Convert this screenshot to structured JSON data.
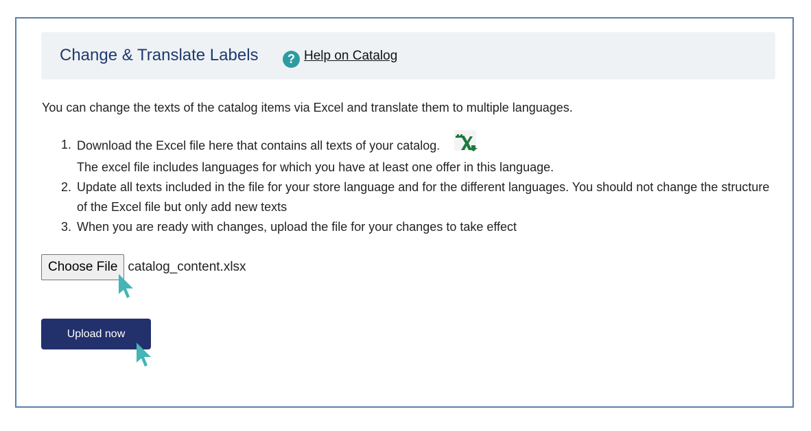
{
  "header": {
    "title": "Change & Translate Labels",
    "help_icon": "question-circle-icon",
    "help_link": "Help on Catalog"
  },
  "intro": "You can change the texts of the catalog items via Excel and translate them to multiple languages.",
  "steps": [
    {
      "num": "1.",
      "text": "Download the Excel file here that contains all texts of your catalog.",
      "icon": "excel-download-icon",
      "note": "The excel file includes languages for which you have at least one offer in this language."
    },
    {
      "num": "2.",
      "text": "Update all texts included in the file for your store language and for the different languages. You should not change the structure of the Excel file but only add new texts"
    },
    {
      "num": "3.",
      "text": "When you are ready with changes, upload the file for your changes to take effect"
    }
  ],
  "file_input": {
    "button_label": "Choose File",
    "file_name": "catalog_content.xlsx"
  },
  "upload_button": "Upload now",
  "colors": {
    "title": "#1f3a6e",
    "header_bg": "#eff2f5",
    "frame_border": "#5a7fa8",
    "help_icon": "#2d9ca2",
    "upload_bg": "#22306c",
    "cursor": "#45b5b5",
    "excel_green": "#1d7a3e"
  }
}
